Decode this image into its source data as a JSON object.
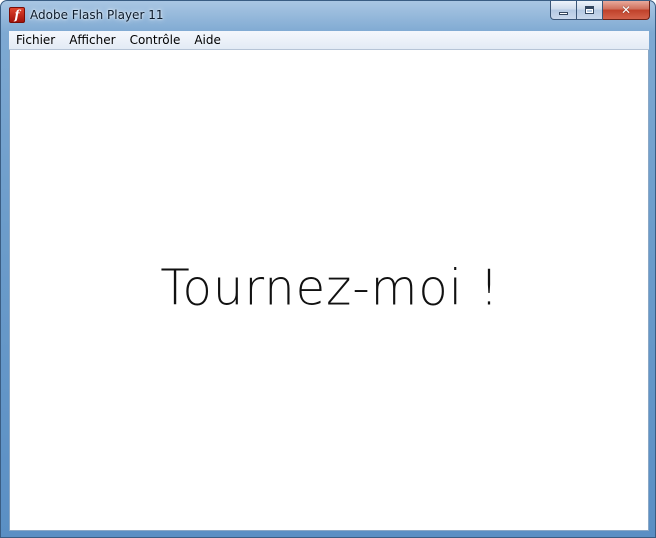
{
  "window": {
    "title": "Adobe Flash Player 11",
    "icon": "flash-icon",
    "icon_glyph": "f",
    "controls": {
      "minimize_icon": "minimize-icon",
      "maximize_icon": "maximize-icon",
      "close_icon": "close-icon",
      "close_glyph": "✕"
    }
  },
  "menu": {
    "items": [
      "Fichier",
      "Afficher",
      "Contrôle",
      "Aide"
    ]
  },
  "stage": {
    "text": "Tournez-moi !"
  },
  "colors": {
    "titlebar": "#6d9dcb",
    "close_button": "#c0412a",
    "content_background": "#ffffff",
    "text": "#111111"
  }
}
